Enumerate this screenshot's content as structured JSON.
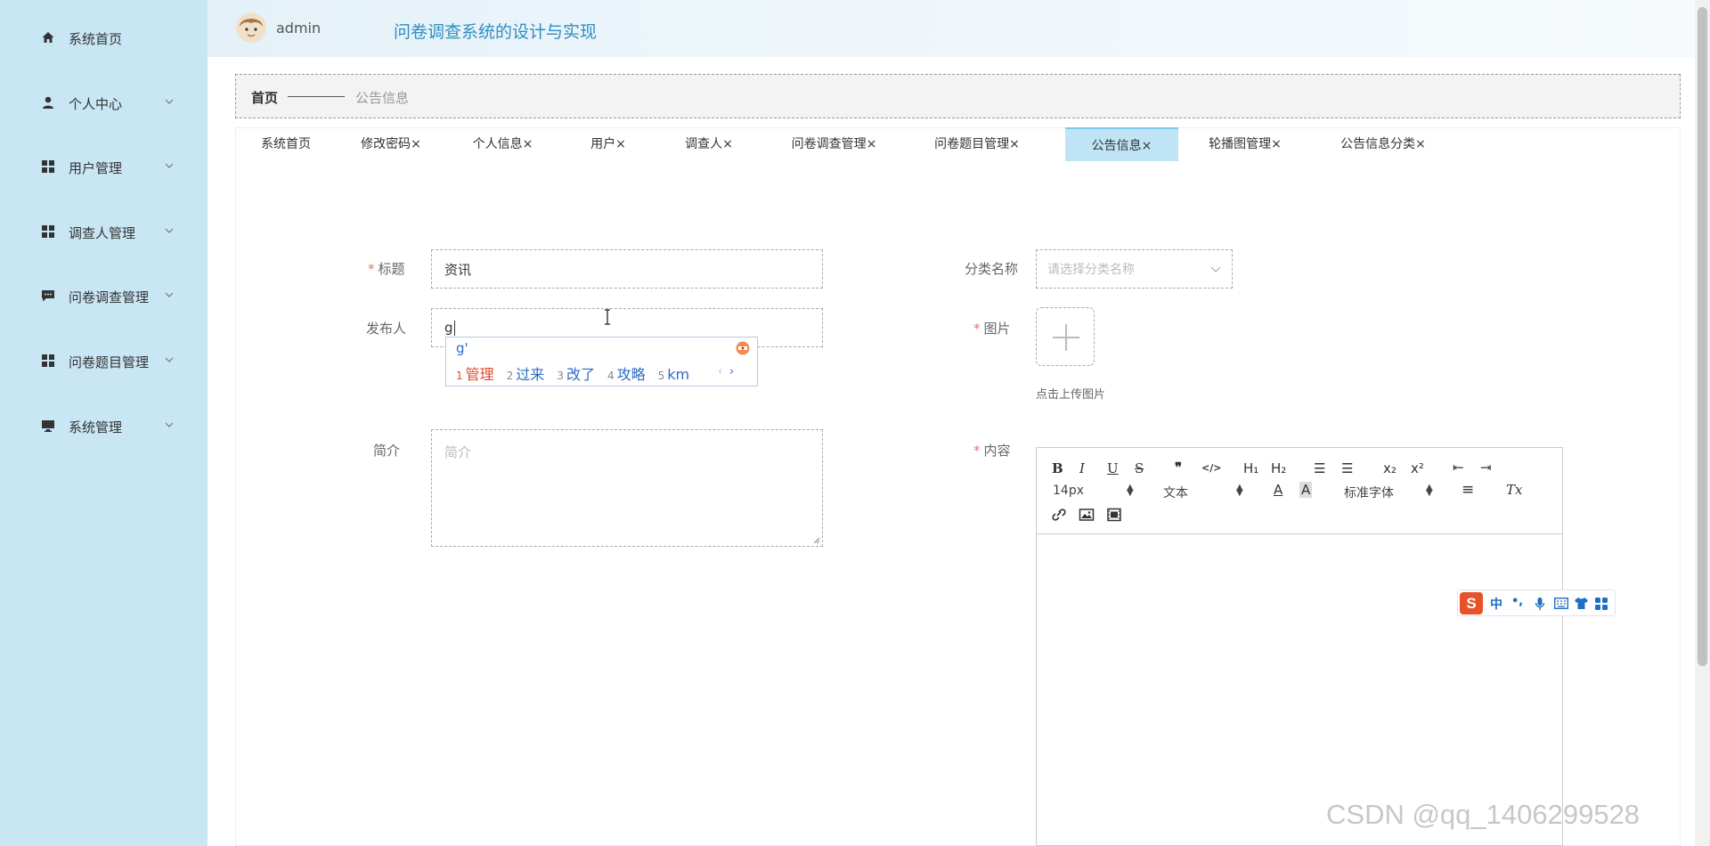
{
  "sidebar": {
    "items": [
      {
        "label": "系统首页",
        "icon": "home-icon"
      },
      {
        "label": "个人中心",
        "icon": "user-icon"
      },
      {
        "label": "用户管理",
        "icon": "grid-icon"
      },
      {
        "label": "调查人管理",
        "icon": "grid-icon"
      },
      {
        "label": "问卷调查管理",
        "icon": "chat-icon"
      },
      {
        "label": "问卷题目管理",
        "icon": "grid-icon"
      },
      {
        "label": "系统管理",
        "icon": "monitor-icon"
      }
    ]
  },
  "header": {
    "user_name": "admin",
    "app_title": "问卷调查系统的设计与实现"
  },
  "breadcrumb": {
    "home": "首页",
    "current": "公告信息"
  },
  "tabs": [
    {
      "label": "系统首页",
      "closable": false
    },
    {
      "label": "修改密码",
      "closable": true
    },
    {
      "label": "个人信息",
      "closable": true
    },
    {
      "label": "用户",
      "closable": true
    },
    {
      "label": "调查人",
      "closable": true
    },
    {
      "label": "问卷调查管理",
      "closable": true
    },
    {
      "label": "问卷题目管理",
      "closable": true
    },
    {
      "label": "公告信息",
      "closable": true,
      "active": true
    },
    {
      "label": "轮播图管理",
      "closable": true
    },
    {
      "label": "公告信息分类",
      "closable": true
    }
  ],
  "tab_close_glyph": "×",
  "form": {
    "title_label": "标题",
    "title_value": "资讯",
    "category_label": "分类名称",
    "category_placeholder": "请选择分类名称",
    "publisher_label": "发布人",
    "publisher_value": "g",
    "image_label": "图片",
    "upload_tip": "点击上传图片",
    "intro_label": "简介",
    "intro_placeholder": "简介",
    "content_label": "内容",
    "required_mark": "*"
  },
  "editor": {
    "font_size": "14px",
    "block_format": "文本",
    "font_family": "标准字体",
    "buttons": {
      "bold": "B",
      "italic": "I",
      "underline": "U",
      "strike": "S",
      "quote": "❞",
      "code": "</>",
      "h1": "H₁",
      "h2": "H₂",
      "ordered_list": "☰",
      "bullet_list": "☰",
      "subscript": "x₂",
      "superscript": "x²",
      "outdent": "⇤",
      "indent": "⇥",
      "color": "A",
      "background": "A",
      "align": "≡",
      "clean": "Tx",
      "link": "🔗",
      "image": "▣",
      "video": "▦"
    }
  },
  "ime": {
    "composition": "g'",
    "candidates": [
      {
        "num": "1",
        "text": "管理"
      },
      {
        "num": "2",
        "text": "过来"
      },
      {
        "num": "3",
        "text": "改了"
      },
      {
        "num": "4",
        "text": "攻略"
      },
      {
        "num": "5",
        "text": "km"
      }
    ],
    "bar": {
      "logo": "S",
      "mode": "中",
      "punct": "•,"
    }
  },
  "watermark": "CSDN @qq_1406299528",
  "colors": {
    "sidebar_bg": "#c9e6f5",
    "active_tab": "#bfe4f6",
    "title_blue": "#2f8fc0",
    "required_red": "#f56c6c",
    "ime_blue": "#2d6cc0",
    "ime_orange": "#e24a2b"
  }
}
